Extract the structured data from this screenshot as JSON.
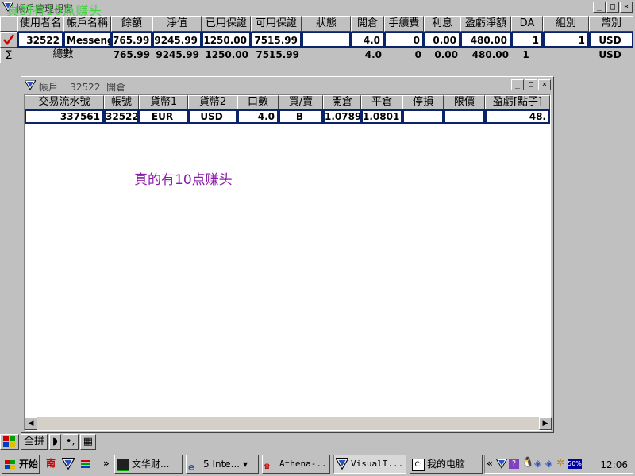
{
  "main_window": {
    "title": "帳戶管理視窗",
    "overlay_text": "真的有10点赚头"
  },
  "account_grid": {
    "headers": [
      "使用者名",
      "帳戶名稱",
      "餘額",
      "淨值",
      "已用保證",
      "可用保證",
      "狀態",
      "開倉",
      "手續費",
      "利息",
      "盈虧淨額",
      "DA",
      "組別",
      "幣別"
    ],
    "row": {
      "user": "32522",
      "name": "Messeng",
      "balance": "765.99",
      "equity": "9245.99",
      "used_margin": "1250.00",
      "free_margin": "7515.99",
      "status": "",
      "open": "4.0",
      "fee": "0",
      "interest": "0.00",
      "pl": "480.00",
      "da": "1",
      "group": "1",
      "currency": "USD"
    },
    "total": {
      "label": "總數",
      "balance": "765.99",
      "equity": "9245.99",
      "used_margin": "1250.00",
      "free_margin": "7515.99",
      "open": "4.0",
      "fee": "0",
      "interest": "0.00",
      "pl": "480.00",
      "da": "1",
      "currency": "USD"
    }
  },
  "sub_window": {
    "title_prefix": "帳戶",
    "account": "32522",
    "title_suffix": "開倉",
    "headers": [
      "交易流水號",
      "帳號",
      "貨幣1",
      "貨幣2",
      "口數",
      "買/賣",
      "開倉",
      "平倉",
      "停損",
      "限價",
      "盈虧[點子]"
    ],
    "row": {
      "serial": "337561",
      "account": "32522",
      "cur1": "EUR",
      "cur2": "USD",
      "lots": "4.0",
      "side": "B",
      "open": "1.0789",
      "close": "1.0801",
      "stop": "",
      "limit": "",
      "pl": "48."
    },
    "note": "真的有10点赚头"
  },
  "bottom_toolbar": {
    "all_label": "全拼"
  },
  "taskbar": {
    "start_label": "开始",
    "nan_label": "南",
    "tasks": [
      "文华财...",
      "5 Inte...",
      "Athena-...",
      "VisualT...",
      "我的电脑"
    ],
    "tray_percent": "50%",
    "clock": "12:06"
  },
  "colors": {
    "window_bg": "#c0c0c0",
    "overlay_green": "#49d049",
    "note_purple": "#8b1aa8",
    "selection_border": "#0a246a",
    "check_red": "#d00000"
  }
}
